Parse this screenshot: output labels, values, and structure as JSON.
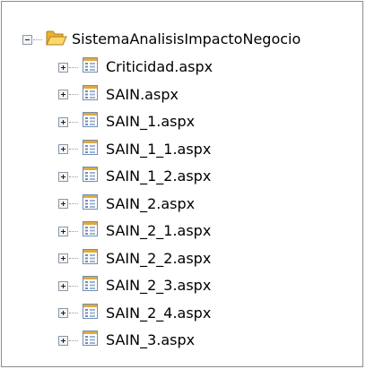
{
  "tree": {
    "root": {
      "label": "SistemaAnalisisImpactoNegocio",
      "icon": "open-folder-icon"
    },
    "files": [
      {
        "label": "Criticidad.aspx",
        "icon": "aspx-page-icon"
      },
      {
        "label": "SAIN.aspx",
        "icon": "aspx-page-icon"
      },
      {
        "label": "SAIN_1.aspx",
        "icon": "aspx-page-icon"
      },
      {
        "label": "SAIN_1_1.aspx",
        "icon": "aspx-page-icon"
      },
      {
        "label": "SAIN_1_2.aspx",
        "icon": "aspx-page-icon"
      },
      {
        "label": "SAIN_2.aspx",
        "icon": "aspx-page-icon"
      },
      {
        "label": "SAIN_2_1.aspx",
        "icon": "aspx-page-icon"
      },
      {
        "label": "SAIN_2_2.aspx",
        "icon": "aspx-page-icon"
      },
      {
        "label": "SAIN_2_3.aspx",
        "icon": "aspx-page-icon"
      },
      {
        "label": "SAIN_2_4.aspx",
        "icon": "aspx-page-icon"
      },
      {
        "label": "SAIN_3.aspx",
        "icon": "aspx-page-icon"
      }
    ]
  },
  "colors": {
    "folder": "#f5c343",
    "page_border": "#6e8eb8",
    "page_header": "#e1aa3a"
  }
}
